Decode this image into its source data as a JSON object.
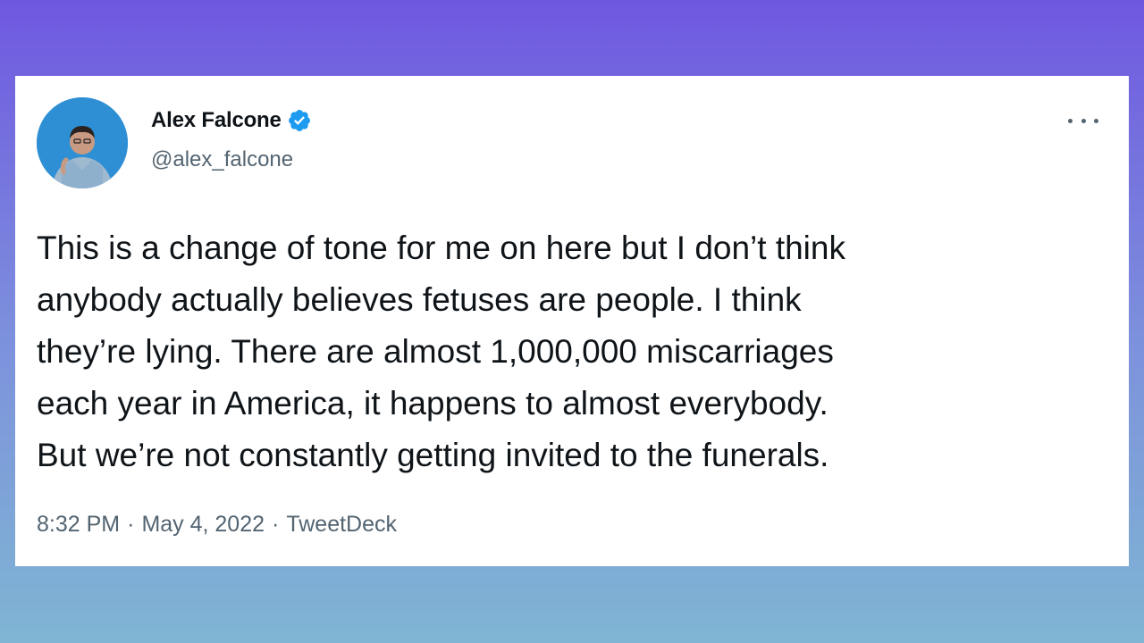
{
  "tweet": {
    "display_name": "Alex Falcone",
    "handle": "@alex_falcone",
    "verified": true,
    "text": "This is a change of tone for me on here but I don’t think\nanybody actually believes fetuses are people. I think\nthey’re lying. There are almost 1,000,000 miscarriages\neach year in America, it happens to almost everybody.\nBut we’re not constantly getting invited to the funerals.",
    "time": "8:32 PM",
    "date": "May 4, 2022",
    "source": "TweetDeck",
    "separator": "·"
  },
  "icons": {
    "verified": "verified-badge-icon",
    "more": "more-options-icon"
  },
  "colors": {
    "background_top": "#6f58e0",
    "background_bottom": "#7fb5d3",
    "card": "#ffffff",
    "text_primary": "#0f1419",
    "text_secondary": "#536471",
    "verified": "#1d9bf0",
    "avatar_bg": "#2f8fd4"
  }
}
